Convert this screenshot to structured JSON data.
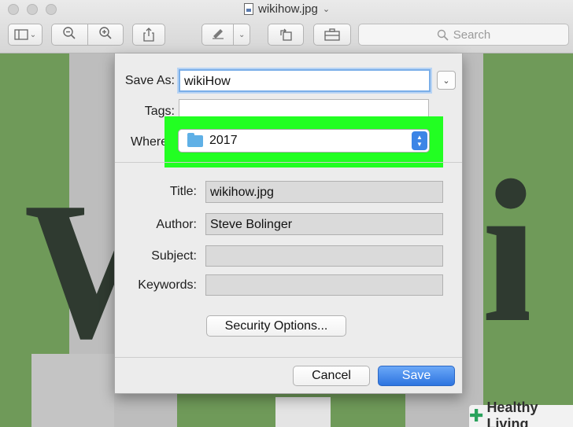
{
  "window": {
    "title": "wikihow.jpg",
    "search_placeholder": "Search"
  },
  "dialog": {
    "save_as_label": "Save As:",
    "save_as_value": "wikiHow",
    "tags_label": "Tags:",
    "tags_value": "",
    "where_label": "Where",
    "where_value": "2017",
    "title_label": "Title:",
    "title_value": "wikihow.jpg",
    "author_label": "Author:",
    "author_value": "Steve Bolinger",
    "subject_label": "Subject:",
    "subject_value": "",
    "keywords_label": "Keywords:",
    "keywords_value": "",
    "security_button": "Security Options...",
    "cancel_button": "Cancel",
    "save_button": "Save"
  },
  "watermark": {
    "brand": "Healthy Living"
  },
  "colors": {
    "highlight": "#22ff22",
    "primary_button": "#2d74e0",
    "background_green": "#6f9a59"
  }
}
